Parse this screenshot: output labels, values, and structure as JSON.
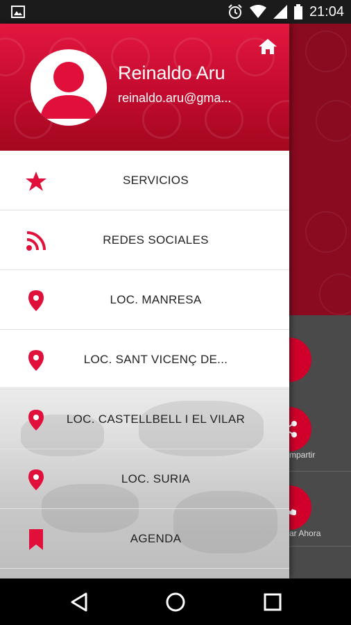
{
  "status_bar": {
    "time": "21:04",
    "icons": [
      "image-icon",
      "alarm-icon",
      "wifi-icon",
      "signal-icon",
      "battery-icon"
    ]
  },
  "drawer": {
    "header": {
      "user_name": "Reinaldo Aru",
      "user_email": "reinaldo.aru@gma...",
      "home_icon": "home-icon"
    },
    "items": [
      {
        "label": "SERVICIOS",
        "icon": "star-icon"
      },
      {
        "label": "REDES SOCIALES",
        "icon": "rss-icon"
      },
      {
        "label": "LOC. MANRESA",
        "icon": "location-pin-icon"
      },
      {
        "label": "LOC. SANT VICENÇ DE...",
        "icon": "location-pin-icon"
      },
      {
        "label": "LOC. CASTELLBELL I EL VILAR",
        "icon": "location-pin-icon"
      },
      {
        "label": "LOC. SURIA",
        "icon": "location-pin-icon"
      },
      {
        "label": "AGENDA",
        "icon": "bookmark-icon"
      }
    ]
  },
  "background_app": {
    "share_label": "mpartir",
    "call_label": "ar Ahora"
  },
  "colors": {
    "accent": "#e0103a",
    "header_dark": "#a3081f"
  },
  "nav_bar": {
    "icons": [
      "back-icon",
      "home-circle-icon",
      "recents-icon"
    ]
  }
}
